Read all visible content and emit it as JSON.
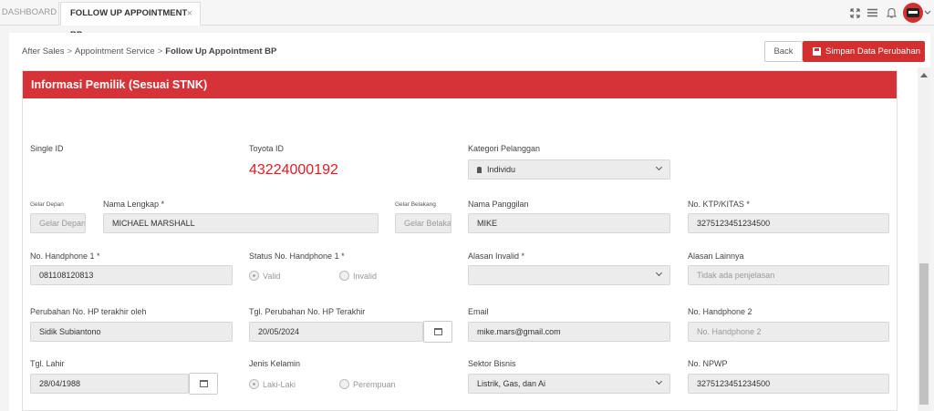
{
  "tabs": {
    "dashboard": "DASHBOARD",
    "active": "FOLLOW UP APPOINTMENT BP",
    "close": "×"
  },
  "icons": [
    "expand-icon",
    "menu-icon",
    "bell-icon",
    "avatar",
    "chevron-down-icon"
  ],
  "breadcrumb": {
    "item1": "After Sales",
    "item2": "Appointment Service",
    "item3": "Follow Up Appointment BP",
    "sep": ">"
  },
  "buttons": {
    "back": "Back",
    "save": "Simpan Data Perubahan"
  },
  "section_title": "Informasi Pemilik (Sesuai STNK)",
  "form": {
    "single_id": {
      "label": "Single ID"
    },
    "toyota_id": {
      "label": "Toyota ID",
      "value": "43224000192"
    },
    "kategori": {
      "label": "Kategori Pelanggan",
      "value": "Individu"
    },
    "gelar_depan": {
      "label": "Gelar Depan",
      "placeholder": "Gelar Depan"
    },
    "nama_lengkap": {
      "label": "Nama Lengkap *",
      "value": "MICHAEL MARSHALL"
    },
    "gelar_belakang": {
      "label": "Gelar Belakang",
      "placeholder": "Gelar Belakang"
    },
    "nama_panggilan": {
      "label": "Nama Panggilan",
      "value": "MIKE"
    },
    "ktp": {
      "label": "No. KTP/KITAS *",
      "value": "3275123451234500"
    },
    "hp1": {
      "label": "No. Handphone 1 *",
      "value": "081108120813"
    },
    "status_hp1": {
      "label": "Status No. Handphone 1 *",
      "opt_valid": "Valid",
      "opt_invalid": "Invalid"
    },
    "alasan_invalid": {
      "label": "Alasan Invalid *",
      "value": ""
    },
    "alasan_lainnya": {
      "label": "Alasan Lainnya",
      "placeholder": "Tidak ada penjelasan"
    },
    "perubahan_oleh": {
      "label": "Perubahan No. HP terakhir oleh",
      "value": "Sidik Subiantono"
    },
    "tgl_perubahan": {
      "label": "Tgl. Perubahan No. HP Terakhir",
      "value": "20/05/2024"
    },
    "email": {
      "label": "Email",
      "value": "mike.mars@gmail.com"
    },
    "hp2": {
      "label": "No. Handphone 2",
      "placeholder": "No. Handphone 2"
    },
    "tgl_lahir": {
      "label": "Tgl. Lahir",
      "value": "28/04/1988"
    },
    "jenis_kelamin": {
      "label": "Jenis Kelamin",
      "opt_laki": "Laki-Laki",
      "opt_perempuan": "Perempuan"
    },
    "sektor": {
      "label": "Sektor Bisnis",
      "value": "Listrik, Gas, dan Ai"
    },
    "npwp": {
      "label": "No. NPWP",
      "value": "3275123451234500"
    }
  },
  "colors": {
    "accent": "#d63339",
    "toyota_id": "#e31b23"
  }
}
